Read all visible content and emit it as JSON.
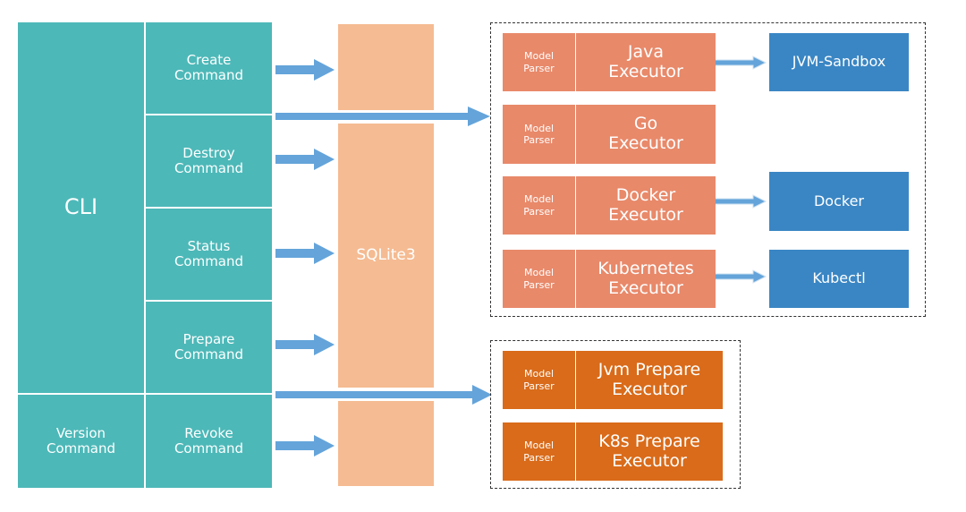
{
  "colors": {
    "cli": "#4db8b8",
    "sqlite": "#f5bb92",
    "executor": "#e8896a",
    "prepare_executor": "#d96b1a",
    "target": "#3a86c4",
    "arrow": "#64a4da"
  },
  "cli": {
    "label": "CLI",
    "version": "Version\nCommand",
    "commands": [
      "Create\nCommand",
      "Destroy\nCommand",
      "Status\nCommand",
      "Prepare\nCommand",
      "Revoke\nCommand"
    ]
  },
  "storage": {
    "label": "SQLite3"
  },
  "executors": [
    {
      "parser": "Model\nParser",
      "name": "Java\nExecutor",
      "target": "JVM-Sandbox"
    },
    {
      "parser": "Model\nParser",
      "name": "Go\nExecutor",
      "target": null
    },
    {
      "parser": "Model\nParser",
      "name": "Docker\nExecutor",
      "target": "Docker"
    },
    {
      "parser": "Model\nParser",
      "name": "Kubernetes\nExecutor",
      "target": "Kubectl"
    }
  ],
  "prepare_executors": [
    {
      "parser": "Model\nParser",
      "name": "Jvm Prepare\nExecutor"
    },
    {
      "parser": "Model\nParser",
      "name": "K8s Prepare\nExecutor"
    }
  ]
}
